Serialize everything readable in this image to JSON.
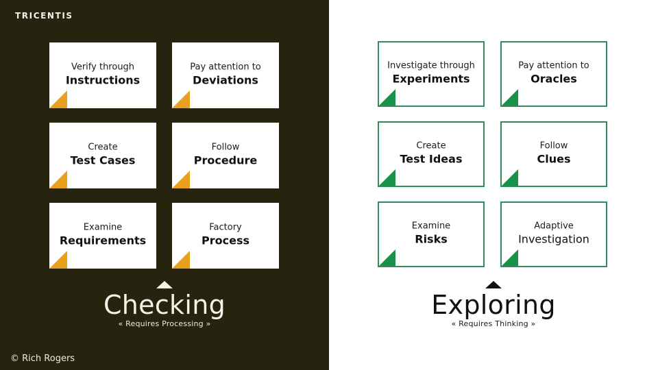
{
  "slide": {
    "logo": "TRICENTIS",
    "copyright": "© Rich Rogers"
  },
  "colors": {
    "dark_panel": "#26240f",
    "light_panel": "#ffffff",
    "checking_accent": "#e8a11e",
    "exploring_accent": "#18914b",
    "exploring_border": "#2e8b57"
  },
  "columns": [
    {
      "key": "checking",
      "title": "Checking",
      "subtitle": "« Requires Processing »",
      "arrow": "triangle-up-icon",
      "cards": [
        {
          "line1": "Verify through",
          "line2": "Instructions"
        },
        {
          "line1": "Pay attention to",
          "line2": "Deviations"
        },
        {
          "line1": "Create",
          "line2": "Test Cases"
        },
        {
          "line1": "Follow",
          "line2": "Procedure"
        },
        {
          "line1": "Examine",
          "line2": "Requirements"
        },
        {
          "line1": "Factory",
          "line2": "Process"
        }
      ]
    },
    {
      "key": "exploring",
      "title": "Exploring",
      "subtitle": "« Requires Thinking »",
      "arrow": "triangle-up-icon",
      "cards": [
        {
          "line1": "Investigate through",
          "line2": "Experiments"
        },
        {
          "line1": "Pay attention to",
          "line2": "Oracles"
        },
        {
          "line1": "Create",
          "line2": "Test Ideas"
        },
        {
          "line1": "Follow",
          "line2": "Clues"
        },
        {
          "line1": "Examine",
          "line2": "Risks"
        },
        {
          "line1": "Adaptive",
          "line2": "Investigation"
        }
      ]
    }
  ]
}
